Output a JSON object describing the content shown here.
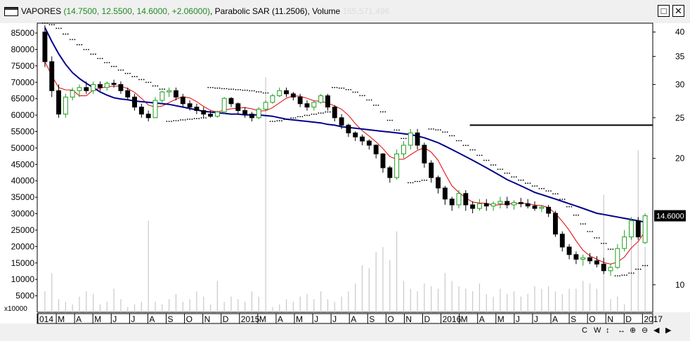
{
  "window": {
    "title_name": "VAPORES",
    "title_quote": "(14.7500, 12.5500, 14.6000, +2.06000)",
    "title_indicator": "Parabolic SAR (11.2506)",
    "title_volume_label": "Volume",
    "title_volume_value": "165,571,496",
    "maximize_symbol": "□",
    "close_symbol": "✕"
  },
  "colors": {
    "up": "#1f9e1f",
    "down": "#000000",
    "ma_short": "#e00000",
    "ma_long": "#00008b",
    "volume": "#c8c8c8",
    "resistance": "#000000",
    "sar": "#000000",
    "price_tag_bg": "#000000",
    "price_tag_fg": "#ffffff"
  },
  "chart_data": {
    "type": "candlestick",
    "left_axis": {
      "ticks": [
        "85000",
        "80000",
        "75000",
        "70000",
        "65000",
        "60000",
        "55000",
        "50000",
        "45000",
        "40000",
        "35000",
        "30000",
        "25000",
        "20000",
        "15000",
        "10000",
        "5000"
      ],
      "multiplier_label": "x10000",
      "ylim": [
        0,
        88000
      ]
    },
    "right_axis": {
      "scale": "log",
      "ticks": [
        "40",
        "35",
        "30",
        "25",
        "20",
        "10"
      ],
      "ylim": [
        8.6,
        42
      ]
    },
    "x_axis_labels": [
      "014",
      "M",
      "A",
      "M",
      "J",
      "J",
      "A",
      "S",
      "O",
      "N",
      "D",
      "2015",
      "M",
      "A",
      "M",
      "J",
      "J",
      "A",
      "S",
      "O",
      "N",
      "D",
      "2016",
      "M",
      "A",
      "M",
      "J",
      "J",
      "A",
      "S",
      "O",
      "N",
      "D",
      "2017"
    ],
    "last_price_label": "14.6000",
    "last_price": 14.6,
    "resistance_level": 24.0,
    "candles": [
      [
        40.0,
        41.5,
        33.0,
        34.0
      ],
      [
        34.0,
        35.0,
        28.0,
        29.0
      ],
      [
        29.0,
        30.0,
        25.0,
        25.5
      ],
      [
        25.5,
        28.5,
        25.0,
        28.0
      ],
      [
        28.0,
        29.5,
        27.5,
        29.0
      ],
      [
        29.0,
        30.0,
        28.0,
        29.5
      ],
      [
        29.5,
        30.5,
        28.5,
        29.0
      ],
      [
        29.0,
        30.5,
        28.5,
        30.0
      ],
      [
        30.0,
        30.5,
        29.0,
        29.5
      ],
      [
        29.5,
        30.5,
        29.0,
        30.2
      ],
      [
        30.2,
        30.8,
        29.5,
        30.0
      ],
      [
        30.0,
        30.5,
        28.5,
        29.0
      ],
      [
        29.0,
        29.5,
        27.5,
        28.0
      ],
      [
        28.0,
        28.5,
        26.0,
        26.5
      ],
      [
        26.5,
        27.0,
        25.0,
        25.5
      ],
      [
        25.5,
        26.0,
        24.5,
        25.0
      ],
      [
        25.0,
        28.0,
        25.0,
        27.5
      ],
      [
        27.5,
        29.0,
        27.0,
        28.8
      ],
      [
        28.8,
        29.5,
        28.0,
        29.0
      ],
      [
        29.0,
        29.5,
        27.5,
        28.0
      ],
      [
        28.0,
        28.5,
        26.5,
        27.0
      ],
      [
        27.0,
        27.5,
        26.0,
        26.5
      ],
      [
        26.5,
        27.0,
        25.5,
        26.0
      ],
      [
        26.0,
        26.5,
        25.0,
        25.5
      ],
      [
        25.5,
        26.0,
        25.0,
        25.2
      ],
      [
        25.2,
        26.0,
        25.0,
        25.8
      ],
      [
        25.8,
        28.0,
        25.5,
        27.8
      ],
      [
        27.8,
        28.0,
        26.5,
        27.0
      ],
      [
        27.0,
        27.2,
        25.5,
        26.0
      ],
      [
        26.0,
        26.5,
        25.0,
        25.5
      ],
      [
        25.5,
        25.8,
        24.5,
        25.0
      ],
      [
        25.0,
        26.5,
        24.8,
        26.2
      ],
      [
        26.2,
        27.5,
        26.0,
        27.2
      ],
      [
        27.2,
        28.5,
        27.0,
        28.2
      ],
      [
        28.2,
        29.5,
        28.0,
        29.0
      ],
      [
        29.0,
        29.5,
        28.0,
        28.5
      ],
      [
        28.5,
        28.8,
        27.5,
        28.0
      ],
      [
        28.0,
        28.5,
        26.5,
        27.0
      ],
      [
        27.0,
        27.5,
        26.0,
        26.5
      ],
      [
        26.5,
        27.5,
        26.0,
        27.2
      ],
      [
        27.2,
        28.5,
        27.0,
        28.2
      ],
      [
        28.2,
        28.5,
        26.0,
        26.5
      ],
      [
        26.5,
        26.8,
        24.5,
        25.0
      ],
      [
        25.0,
        25.5,
        23.5,
        24.0
      ],
      [
        24.0,
        24.2,
        22.5,
        23.0
      ],
      [
        23.0,
        23.2,
        22.0,
        22.5
      ],
      [
        22.5,
        22.8,
        21.5,
        22.0
      ],
      [
        22.0,
        22.2,
        21.0,
        21.5
      ],
      [
        21.5,
        21.6,
        20.0,
        20.5
      ],
      [
        20.5,
        20.6,
        18.5,
        19.0
      ],
      [
        19.0,
        19.2,
        17.5,
        18.0
      ],
      [
        18.0,
        21.0,
        17.8,
        20.5
      ],
      [
        20.5,
        22.0,
        20.0,
        21.5
      ],
      [
        21.5,
        23.5,
        21.0,
        23.0
      ],
      [
        23.0,
        23.5,
        21.0,
        21.5
      ],
      [
        21.5,
        21.8,
        19.0,
        19.5
      ],
      [
        19.5,
        19.8,
        17.5,
        18.0
      ],
      [
        18.0,
        18.2,
        16.5,
        17.0
      ],
      [
        17.0,
        17.2,
        15.5,
        16.0
      ],
      [
        16.0,
        16.2,
        15.0,
        15.5
      ],
      [
        15.5,
        16.8,
        15.2,
        16.5
      ],
      [
        16.5,
        16.8,
        15.0,
        15.5
      ],
      [
        15.5,
        15.8,
        14.8,
        15.2
      ],
      [
        15.2,
        16.0,
        15.0,
        15.6
      ],
      [
        15.6,
        16.0,
        15.0,
        15.4
      ],
      [
        15.4,
        15.8,
        15.0,
        15.6
      ],
      [
        15.6,
        16.2,
        15.2,
        15.8
      ],
      [
        15.8,
        16.2,
        15.2,
        15.5
      ],
      [
        15.5,
        15.9,
        15.1,
        15.7
      ],
      [
        15.7,
        16.1,
        15.3,
        15.6
      ],
      [
        15.6,
        16.0,
        15.2,
        15.4
      ],
      [
        15.4,
        15.8,
        15.0,
        15.2
      ],
      [
        15.2,
        15.5,
        14.9,
        15.3
      ],
      [
        15.3,
        15.5,
        14.5,
        14.8
      ],
      [
        14.8,
        15.0,
        13.0,
        13.2
      ],
      [
        13.2,
        13.4,
        12.0,
        12.3
      ],
      [
        12.3,
        12.5,
        11.5,
        11.8
      ],
      [
        11.8,
        12.0,
        11.2,
        11.5
      ],
      [
        11.5,
        11.8,
        11.1,
        11.6
      ],
      [
        11.6,
        11.9,
        11.2,
        11.4
      ],
      [
        11.4,
        11.7,
        11.0,
        11.2
      ],
      [
        11.2,
        11.6,
        10.6,
        10.8
      ],
      [
        10.8,
        11.2,
        10.5,
        11.0
      ],
      [
        11.0,
        12.5,
        10.9,
        12.2
      ],
      [
        12.2,
        13.5,
        12.0,
        13.0
      ],
      [
        13.0,
        14.5,
        12.8,
        14.2
      ],
      [
        14.2,
        14.5,
        12.8,
        13.0
      ],
      [
        12.6,
        14.8,
        12.5,
        14.6
      ]
    ],
    "volume": [
      0.08,
      0.15,
      0.05,
      0.04,
      0.03,
      0.06,
      0.08,
      0.07,
      0.03,
      0.04,
      0.09,
      0.05,
      0.02,
      0.03,
      0.04,
      0.35,
      0.04,
      0.03,
      0.05,
      0.07,
      0.04,
      0.05,
      0.08,
      0.06,
      0.03,
      0.12,
      0.04,
      0.06,
      0.05,
      0.04,
      0.08,
      0.06,
      0.9,
      0.02,
      0.03,
      0.05,
      0.04,
      0.06,
      0.07,
      0.05,
      0.08,
      0.05,
      0.04,
      0.06,
      0.08,
      0.11,
      0.18,
      0.17,
      0.23,
      0.25,
      0.2,
      0.31,
      0.12,
      0.09,
      0.08,
      0.11,
      0.1,
      0.09,
      0.15,
      0.12,
      0.1,
      0.09,
      0.08,
      0.11,
      0.07,
      0.06,
      0.09,
      0.07,
      0.08,
      0.06,
      0.07,
      0.1,
      0.09,
      0.1,
      0.08,
      0.07,
      0.09,
      0.09,
      0.12,
      0.11,
      0.09,
      0.45,
      0.05,
      0.06,
      0.03,
      0.3,
      0.62,
      0.25
    ],
    "volume_ylim": [
      0,
      1.0
    ]
  }
}
